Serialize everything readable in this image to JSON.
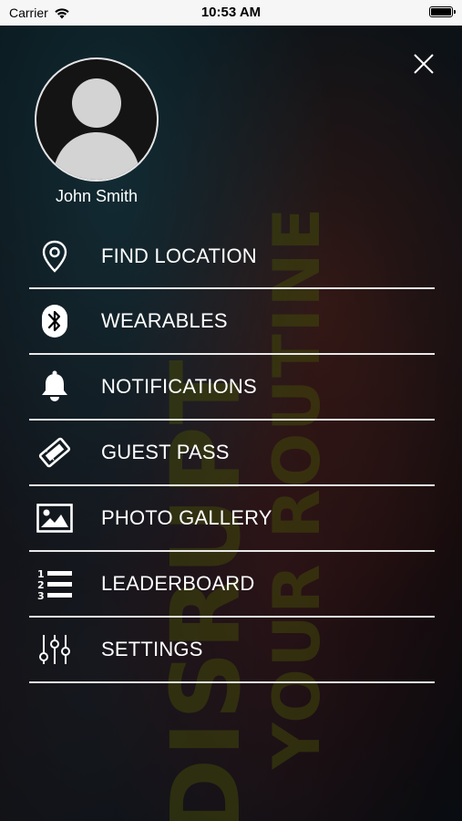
{
  "status_bar": {
    "carrier": "Carrier",
    "time": "10:53 AM",
    "battery_level": 1.0
  },
  "background_text": {
    "line1": "DISRUPT",
    "line2": "YOUR ROUTINE"
  },
  "profile": {
    "name": "John Smith",
    "avatar_icon": "person-icon"
  },
  "menu": {
    "items": [
      {
        "label": "FIND LOCATION",
        "icon": "location-pin-icon"
      },
      {
        "label": "WEARABLES",
        "icon": "bluetooth-icon"
      },
      {
        "label": "NOTIFICATIONS",
        "icon": "bell-icon"
      },
      {
        "label": "GUEST PASS",
        "icon": "ticket-icon"
      },
      {
        "label": "PHOTO GALLERY",
        "icon": "image-icon"
      },
      {
        "label": "LEADERBOARD",
        "icon": "numbered-list-icon"
      },
      {
        "label": "SETTINGS",
        "icon": "sliders-icon"
      }
    ]
  },
  "colors": {
    "text": "#ffffff",
    "divider": "#e9e9e9",
    "accent_background_text": "#6f7a10"
  }
}
